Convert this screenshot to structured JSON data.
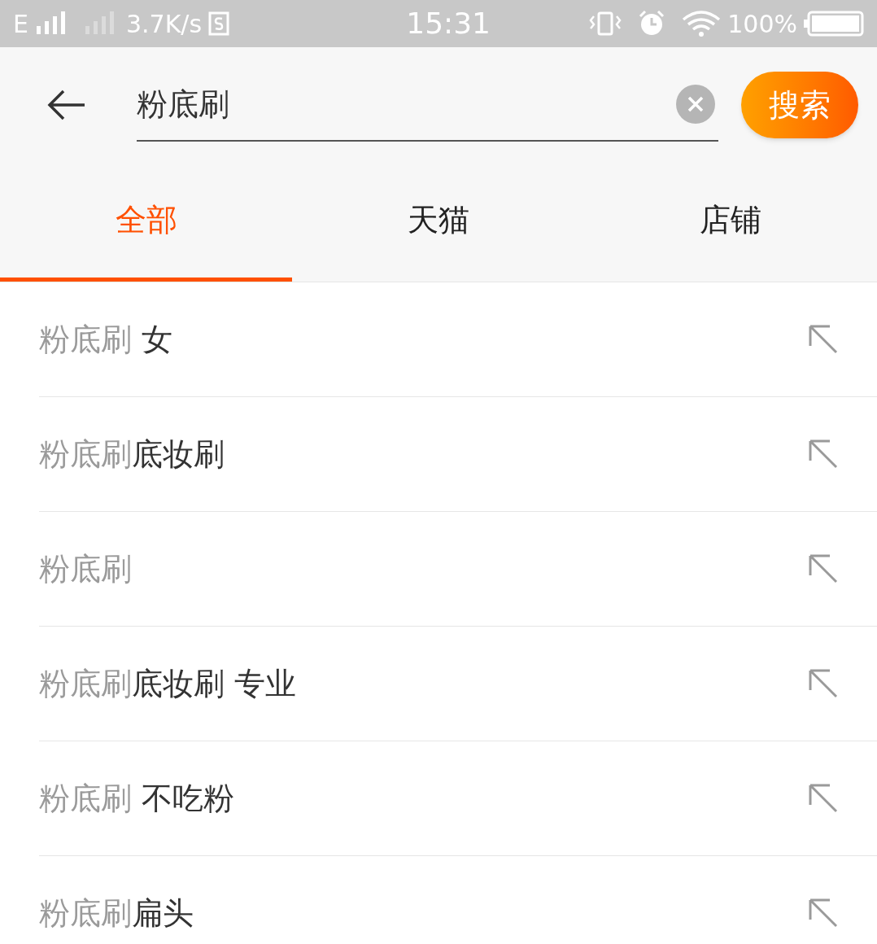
{
  "status_bar": {
    "network": "E",
    "speed": "3.7K/s",
    "time": "15:31",
    "battery": "100%"
  },
  "search": {
    "value": "粉底刷",
    "button": "搜索"
  },
  "tabs": [
    {
      "label": "全部",
      "selected": true
    },
    {
      "label": "天猫",
      "selected": false
    },
    {
      "label": "店铺",
      "selected": false
    }
  ],
  "suggestions": [
    {
      "match": "粉底刷",
      "rest": " 女"
    },
    {
      "match": "粉底刷",
      "rest": "底妆刷"
    },
    {
      "match": "粉底刷"
    },
    {
      "match": "粉底刷",
      "rest": "底妆刷 专业"
    },
    {
      "match": "粉底刷",
      "rest": " 不吃粉"
    },
    {
      "match": "粉底刷",
      "rest": "扁头"
    }
  ]
}
